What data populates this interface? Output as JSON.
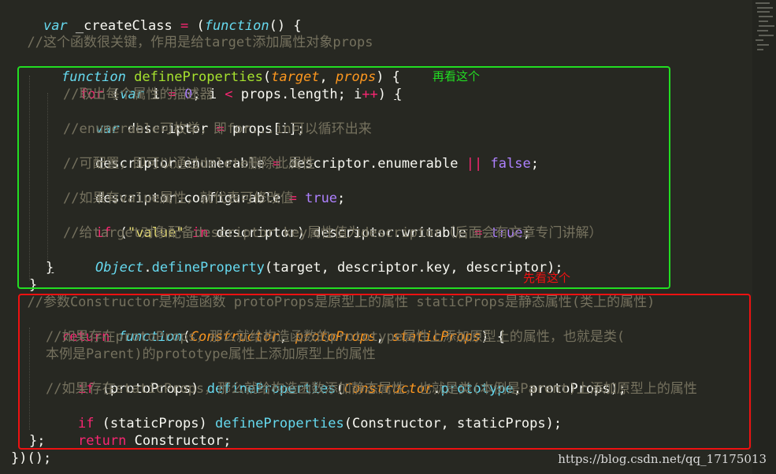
{
  "code": {
    "l1": {
      "var": "var",
      "name": " _createClass ",
      "eq": "=",
      "open": " (",
      "fn": "function",
      "rest": "() {"
    },
    "l3": {
      "text": "  //这个函数很关键，作用是给target添加属性对象props"
    },
    "l4": {
      "fn": "function",
      "name": "defineProperties",
      "p1": "target",
      "p2": "props"
    },
    "l5": {
      "for": "for",
      "var": "var",
      "i": " i ",
      "eq": "=",
      "zero": "0",
      "semi": "; i ",
      "lt": "<",
      "props": " props.length; i",
      "pp": "++",
      ") ": ") ",
      "brace": "{"
    },
    "l6": {
      "text": "//取出每个属性的描述器"
    },
    "l7": {
      "var": "var",
      "rest1": " descriptor ",
      "eq": "=",
      "rest2": " props[i];"
    },
    "l8": {
      "text": "//enumerable可枚举，即for...in可以循环出来"
    },
    "l9": {
      "a": "descriptor.enumerable ",
      "eq": "=",
      "b": " descriptor.enumerable ",
      "or": "||",
      "false": "false",
      "end": ";"
    },
    "l10": {
      "text": "//可配置，即可以通过delete删除此属性"
    },
    "l11": {
      "a": "descriptor.configurable ",
      "eq": "=",
      "true": "true",
      "end": ";"
    },
    "l12": {
      "text": "//如果有value属性，就代表可修改值"
    },
    "l13": {
      "if": "if",
      "open": " (",
      "str": "\"value\"",
      "in": "in",
      "b": " descriptor) descriptor.writable ",
      "eq": "=",
      "true": "true",
      "end": ";"
    },
    "l14": {
      "text": "//给target对象配备descriptor.key属性值为descriptor（后面会有文章专门讲解）"
    },
    "l15": {
      "obj": "Object",
      "dot": ".",
      "method": "defineProperty",
      "rest": "(target, descriptor.key, descriptor);"
    },
    "l16": {
      "brace": "}"
    },
    "l17": {
      "brace": "}"
    },
    "l18": {
      "text": "  //参数Constructor是构造函数 protoProps是原型上的属性 staticProps是静态属性(类上的属性)"
    },
    "l19": {
      "ret": "return",
      "fn": "function",
      "p1": "Constructor",
      "p2": "protoProps",
      "p3": "staticProps"
    },
    "l20": {
      "text": "//如果存在protoProps，那么就给构造函数的prototype属性上添加原型上的属性，也就是类("
    },
    "l21": {
      "text": "本例是Parent)的prototype属性上添加原型上的属性"
    },
    "l22": {
      "if": "if",
      "a": " (protoProps) ",
      "call": "defineProperties",
      "c": "Constructor",
      "proto": "prototype",
      "end": ", protoProps);"
    },
    "l23": {
      "text": "//如果存在staticProps，那么就给构造函数添加静态属性，也就是类(本例是Parent)上添加原型上的属性"
    },
    "l24": {
      "if": "if",
      "a": " (staticProps) ",
      "call": "defineProperties",
      "end": "(Constructor, staticProps);"
    },
    "l25": {
      "ret": "return",
      "rest": " Constructor;"
    },
    "l26": {
      "text": "};"
    },
    "l27": {
      "text": "})();"
    }
  },
  "annotations": {
    "green_label": "再看这个",
    "red_label": "先看这个"
  },
  "watermark": "https://blog.csdn.net/qq_17175013",
  "colors": {
    "background": "#272822",
    "green_box": "#22dd22",
    "red_box": "#ee1111"
  }
}
